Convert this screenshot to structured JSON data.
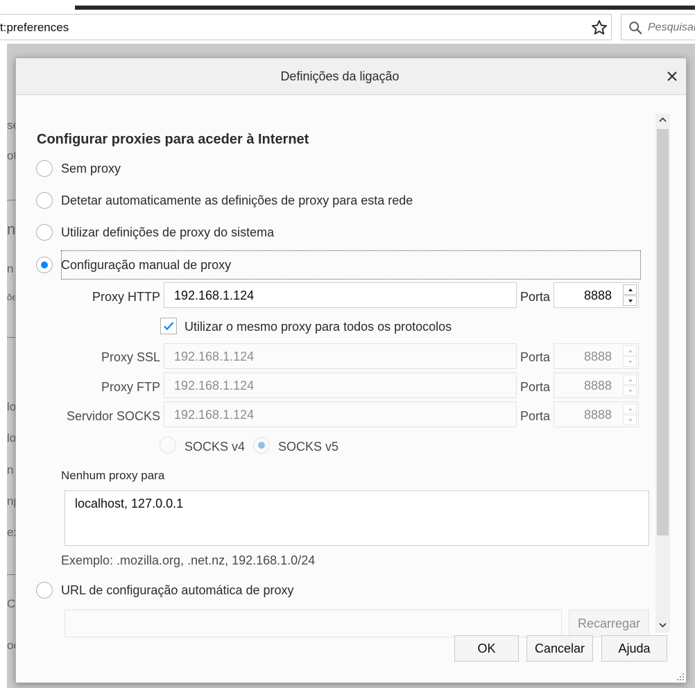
{
  "browser": {
    "url": "t:preferences",
    "search_placeholder": "Pesquisar"
  },
  "background_fragments": [
    "se",
    "ot",
    "ne",
    "n",
    "õe",
    "lo",
    "lo",
    "n t",
    "np",
    "ex",
    "C",
    "oc"
  ],
  "dialog": {
    "title": "Definições da ligação",
    "heading": "Configurar proxies para aceder à Internet",
    "options": {
      "no_proxy": "Sem proxy",
      "auto_detect": "Detetar automaticamente as definições de proxy para esta rede",
      "system": "Utilizar definições de proxy do sistema",
      "manual": "Configuração manual de proxy",
      "pac": "URL de configuração automática de proxy"
    },
    "selected_option": "manual",
    "http": {
      "label": "Proxy HTTP",
      "host": "192.168.1.124",
      "port_label": "Porta",
      "port": "8888"
    },
    "same_proxy": {
      "label": "Utilizar o mesmo proxy para todos os protocolos",
      "checked": true
    },
    "ssl": {
      "label": "Proxy SSL",
      "host": "192.168.1.124",
      "port_label": "Porta",
      "port": "8888"
    },
    "ftp": {
      "label": "Proxy FTP",
      "host": "192.168.1.124",
      "port_label": "Porta",
      "port": "8888"
    },
    "socks": {
      "label": "Servidor SOCKS",
      "host": "192.168.1.124",
      "port_label": "Porta",
      "port": "8888"
    },
    "socks_versions": {
      "v4": "SOCKS v4",
      "v5": "SOCKS v5",
      "selected": "v5"
    },
    "no_proxy_for": {
      "label": "Nenhum proxy para",
      "value": "localhost, 127.0.0.1"
    },
    "example": "Exemplo: .mozilla.org, .net.nz, 192.168.1.0/24",
    "pac_url": "",
    "reload_label": "Recarregar",
    "buttons": {
      "ok": "OK",
      "cancel": "Cancelar",
      "help": "Ajuda"
    }
  },
  "colors": {
    "accent": "#0a84ff",
    "dialog_bg": "#fbfbfb",
    "overlay": "#8a8a8a"
  }
}
